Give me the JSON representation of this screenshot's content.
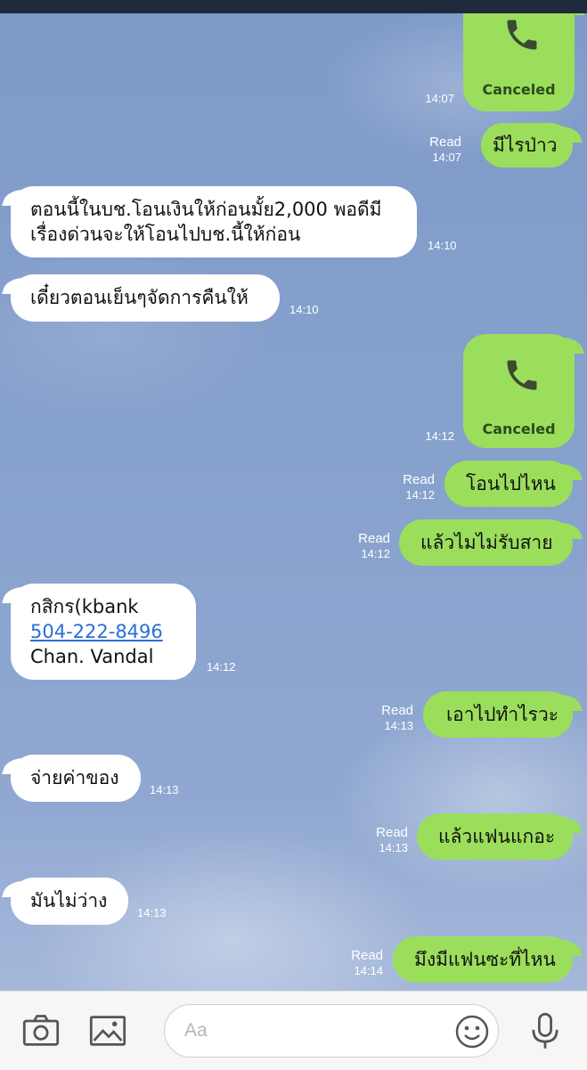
{
  "messages": [
    {
      "dir": "out",
      "type": "call",
      "label": "Canceled",
      "time": "14:07"
    },
    {
      "dir": "out",
      "text": "มีไรป่าว",
      "read": "Read",
      "time": "14:07"
    },
    {
      "dir": "in",
      "lines": [
        "ตอนนี้ในบช.โอนเงินให้ก่อนมั้ย2,000 พอดีมี",
        "เรื่องด่วนจะให้โอนไปบช.นี้ให้ก่อน"
      ],
      "time": "14:10"
    },
    {
      "dir": "in",
      "text": "เดี๋ยวตอนเย็นๆจัดการคืนให้",
      "time": "14:10"
    },
    {
      "dir": "out",
      "type": "call",
      "label": "Canceled",
      "time": "14:12"
    },
    {
      "dir": "out",
      "text": "โอนไปไหน",
      "read": "Read",
      "time": "14:12"
    },
    {
      "dir": "out",
      "text": "แล้วไมไม่รับสาย",
      "read": "Read",
      "time": "14:12"
    },
    {
      "dir": "in",
      "line1": "กสิกร(kbank",
      "link": "504-222-8496",
      "line3": "Chan. Vandal",
      "time": "14:12"
    },
    {
      "dir": "out",
      "text": "เอาไปทำไรวะ",
      "read": "Read",
      "time": "14:13"
    },
    {
      "dir": "in",
      "text": "จ่ายค่าของ",
      "time": "14:13"
    },
    {
      "dir": "out",
      "text": "แล้วแฟนแกอะ",
      "read": "Read",
      "time": "14:13"
    },
    {
      "dir": "in",
      "text": "มันไม่ว่าง",
      "time": "14:13"
    },
    {
      "dir": "out",
      "text": "มึงมีแฟนซะที่ไหน",
      "read": "Read",
      "time": "14:14"
    }
  ],
  "composer": {
    "placeholder": "Aa",
    "icons": [
      "camera-icon",
      "image-icon",
      "emoji-icon",
      "microphone-icon"
    ]
  },
  "colors": {
    "outgoing_bubble": "#9bde5c",
    "incoming_bubble": "#ffffff",
    "link": "#2a6fd6",
    "top_bar": "#1f2a3c"
  }
}
